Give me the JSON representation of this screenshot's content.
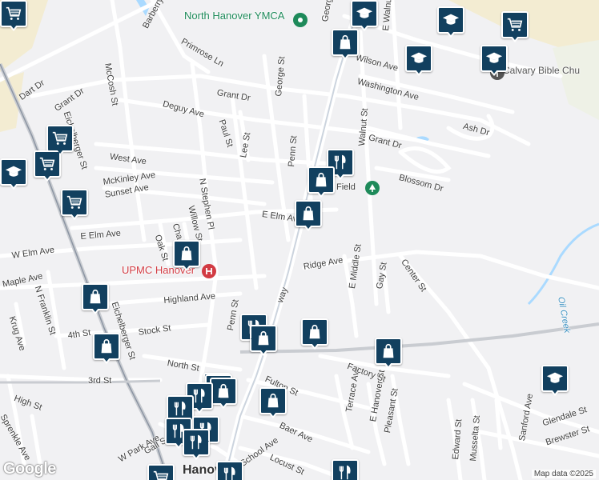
{
  "map": {
    "attribution": "Map data ©2025",
    "logo_text": "Google",
    "colors": {
      "road": "#ffffff",
      "rail": "#c9ccd1",
      "highway": "#aab8c8",
      "water": "#aadaff",
      "land_yellow": "#f3ecd2",
      "park": "#dcefdc",
      "marker": "#12405f",
      "poi_green": "#1e8a5a",
      "hospital_red": "#d23b43"
    }
  },
  "pois": [
    {
      "label": "North Hanover YMCA",
      "kind": "poi",
      "icon": "ymca-icon"
    },
    {
      "label": "UPMC Hanover",
      "kind": "hospital",
      "icon": "hospital-icon"
    },
    {
      "label": "Calvary Bible Chu",
      "kind": "church",
      "icon": "church-icon"
    },
    {
      "label": "Field",
      "kind": "park",
      "icon": "tree-icon"
    },
    {
      "label": "Oil Creek",
      "kind": "water",
      "icon": ""
    },
    {
      "label": "Hanov",
      "kind": "town",
      "icon": ""
    }
  ],
  "streets": [
    "Barberry Dr",
    "Primrose Ln",
    "McCosh St",
    "Dart Dr",
    "Grant Dr",
    "Deguy Ave",
    "Grant Dr",
    "Eichelberger St",
    "West Ave",
    "McKinley Ave",
    "Sunset Ave",
    "Willow St",
    "N Stephen Pl",
    "Lee St",
    "Paul St",
    "George St",
    "Penn St",
    "E Elm Ave",
    "E Elm Ave",
    "W Elm Ave",
    "Maple Ave",
    "N Franklin St",
    "Krug Ave",
    "4th St",
    "Stock St",
    "Eichelberger St",
    "Highland Ave",
    "Ridge Ave",
    "E Middle St",
    "Gay St",
    "Center St",
    "Wilson Ave",
    "Washington Ave",
    "Ash Dr",
    "Grant Dr",
    "Walnut St",
    "Blossom Dr",
    "E Walnut St",
    "North St",
    "3rd St",
    "High St",
    "Sprenkle Ave",
    "W Park Ave",
    "Gall St",
    "Fulton St",
    "Baer Ave",
    "Terrace Ave",
    "E Hanover St",
    "Pleasant St",
    "Factory St",
    "Locust St",
    "School Ave",
    "Edward St",
    "Musselta St",
    "Sanford Ave",
    "Glendale St",
    "Brewster St",
    "Penn St",
    "Oak St",
    "Cha",
    "Georg",
    "way"
  ],
  "markers": [
    {
      "type": "education",
      "icon": "graduation-cap-icon"
    },
    {
      "type": "shopping",
      "icon": "shopping-bag-icon"
    },
    {
      "type": "education",
      "icon": "graduation-cap-icon"
    },
    {
      "type": "grocery",
      "icon": "shopping-cart-icon"
    },
    {
      "type": "education",
      "icon": "graduation-cap-icon"
    },
    {
      "type": "education",
      "icon": "graduation-cap-icon"
    },
    {
      "type": "grocery",
      "icon": "shopping-cart-icon"
    },
    {
      "type": "grocery",
      "icon": "shopping-cart-icon"
    },
    {
      "type": "grocery",
      "icon": "shopping-cart-icon"
    },
    {
      "type": "education",
      "icon": "graduation-cap-icon"
    },
    {
      "type": "restaurant",
      "icon": "fork-knife-icon"
    },
    {
      "type": "shopping",
      "icon": "shopping-bag-icon"
    },
    {
      "type": "grocery",
      "icon": "shopping-cart-icon"
    },
    {
      "type": "shopping",
      "icon": "shopping-bag-icon"
    },
    {
      "type": "shopping",
      "icon": "shopping-bag-icon"
    },
    {
      "type": "shopping",
      "icon": "shopping-bag-icon"
    },
    {
      "type": "shopping",
      "icon": "shopping-bag-icon"
    },
    {
      "type": "restaurant",
      "icon": "fork-knife-icon"
    },
    {
      "type": "shopping",
      "icon": "shopping-bag-icon"
    },
    {
      "type": "shopping",
      "icon": "shopping-bag-icon"
    },
    {
      "type": "shopping",
      "icon": "shopping-bag-icon"
    },
    {
      "type": "education",
      "icon": "graduation-cap-icon"
    },
    {
      "type": "shopping",
      "icon": "shopping-bag-icon"
    },
    {
      "type": "restaurant",
      "icon": "fork-knife-icon"
    },
    {
      "type": "shopping",
      "icon": "shopping-bag-icon"
    },
    {
      "type": "shopping",
      "icon": "shopping-bag-icon"
    },
    {
      "type": "restaurant",
      "icon": "fork-knife-icon"
    },
    {
      "type": "restaurant",
      "icon": "fork-knife-icon"
    },
    {
      "type": "restaurant",
      "icon": "fork-knife-icon"
    },
    {
      "type": "restaurant",
      "icon": "fork-knife-icon"
    },
    {
      "type": "restaurant",
      "icon": "fork-knife-icon"
    },
    {
      "type": "grocery",
      "icon": "shopping-cart-icon"
    },
    {
      "type": "restaurant",
      "icon": "fork-knife-icon"
    },
    {
      "type": "restaurant",
      "icon": "fork-knife-icon"
    }
  ]
}
